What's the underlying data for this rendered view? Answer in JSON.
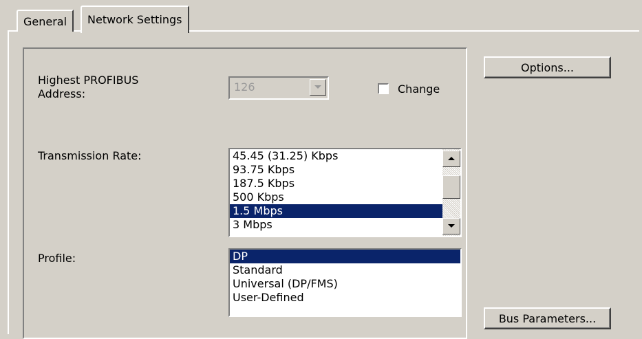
{
  "tabs": [
    {
      "label": "General",
      "active": false
    },
    {
      "label": "Network Settings",
      "active": true
    }
  ],
  "highest_address": {
    "label_line1": "Highest PROFIBUS",
    "label_line2": "Address:",
    "value": "126",
    "enabled": false
  },
  "change_checkbox": {
    "label": "Change",
    "checked": false
  },
  "transmission_rate": {
    "label": "Transmission Rate:",
    "options": [
      "45.45 (31.25) Kbps",
      "93.75 Kbps",
      "187.5 Kbps",
      "500 Kbps",
      "1.5 Mbps",
      "3 Mbps"
    ],
    "selected": "1.5 Mbps"
  },
  "profile": {
    "label": "Profile:",
    "options": [
      "DP",
      "Standard",
      "Universal (DP/FMS)",
      "User-Defined"
    ],
    "selected": "DP"
  },
  "buttons": {
    "options": "Options...",
    "bus_parameters": "Bus Parameters..."
  },
  "colors": {
    "dialog_bg": "#d4d0c8",
    "selection_bg": "#0a246a",
    "selection_text": "#ffffff",
    "disabled_text": "#9a9a9a"
  }
}
